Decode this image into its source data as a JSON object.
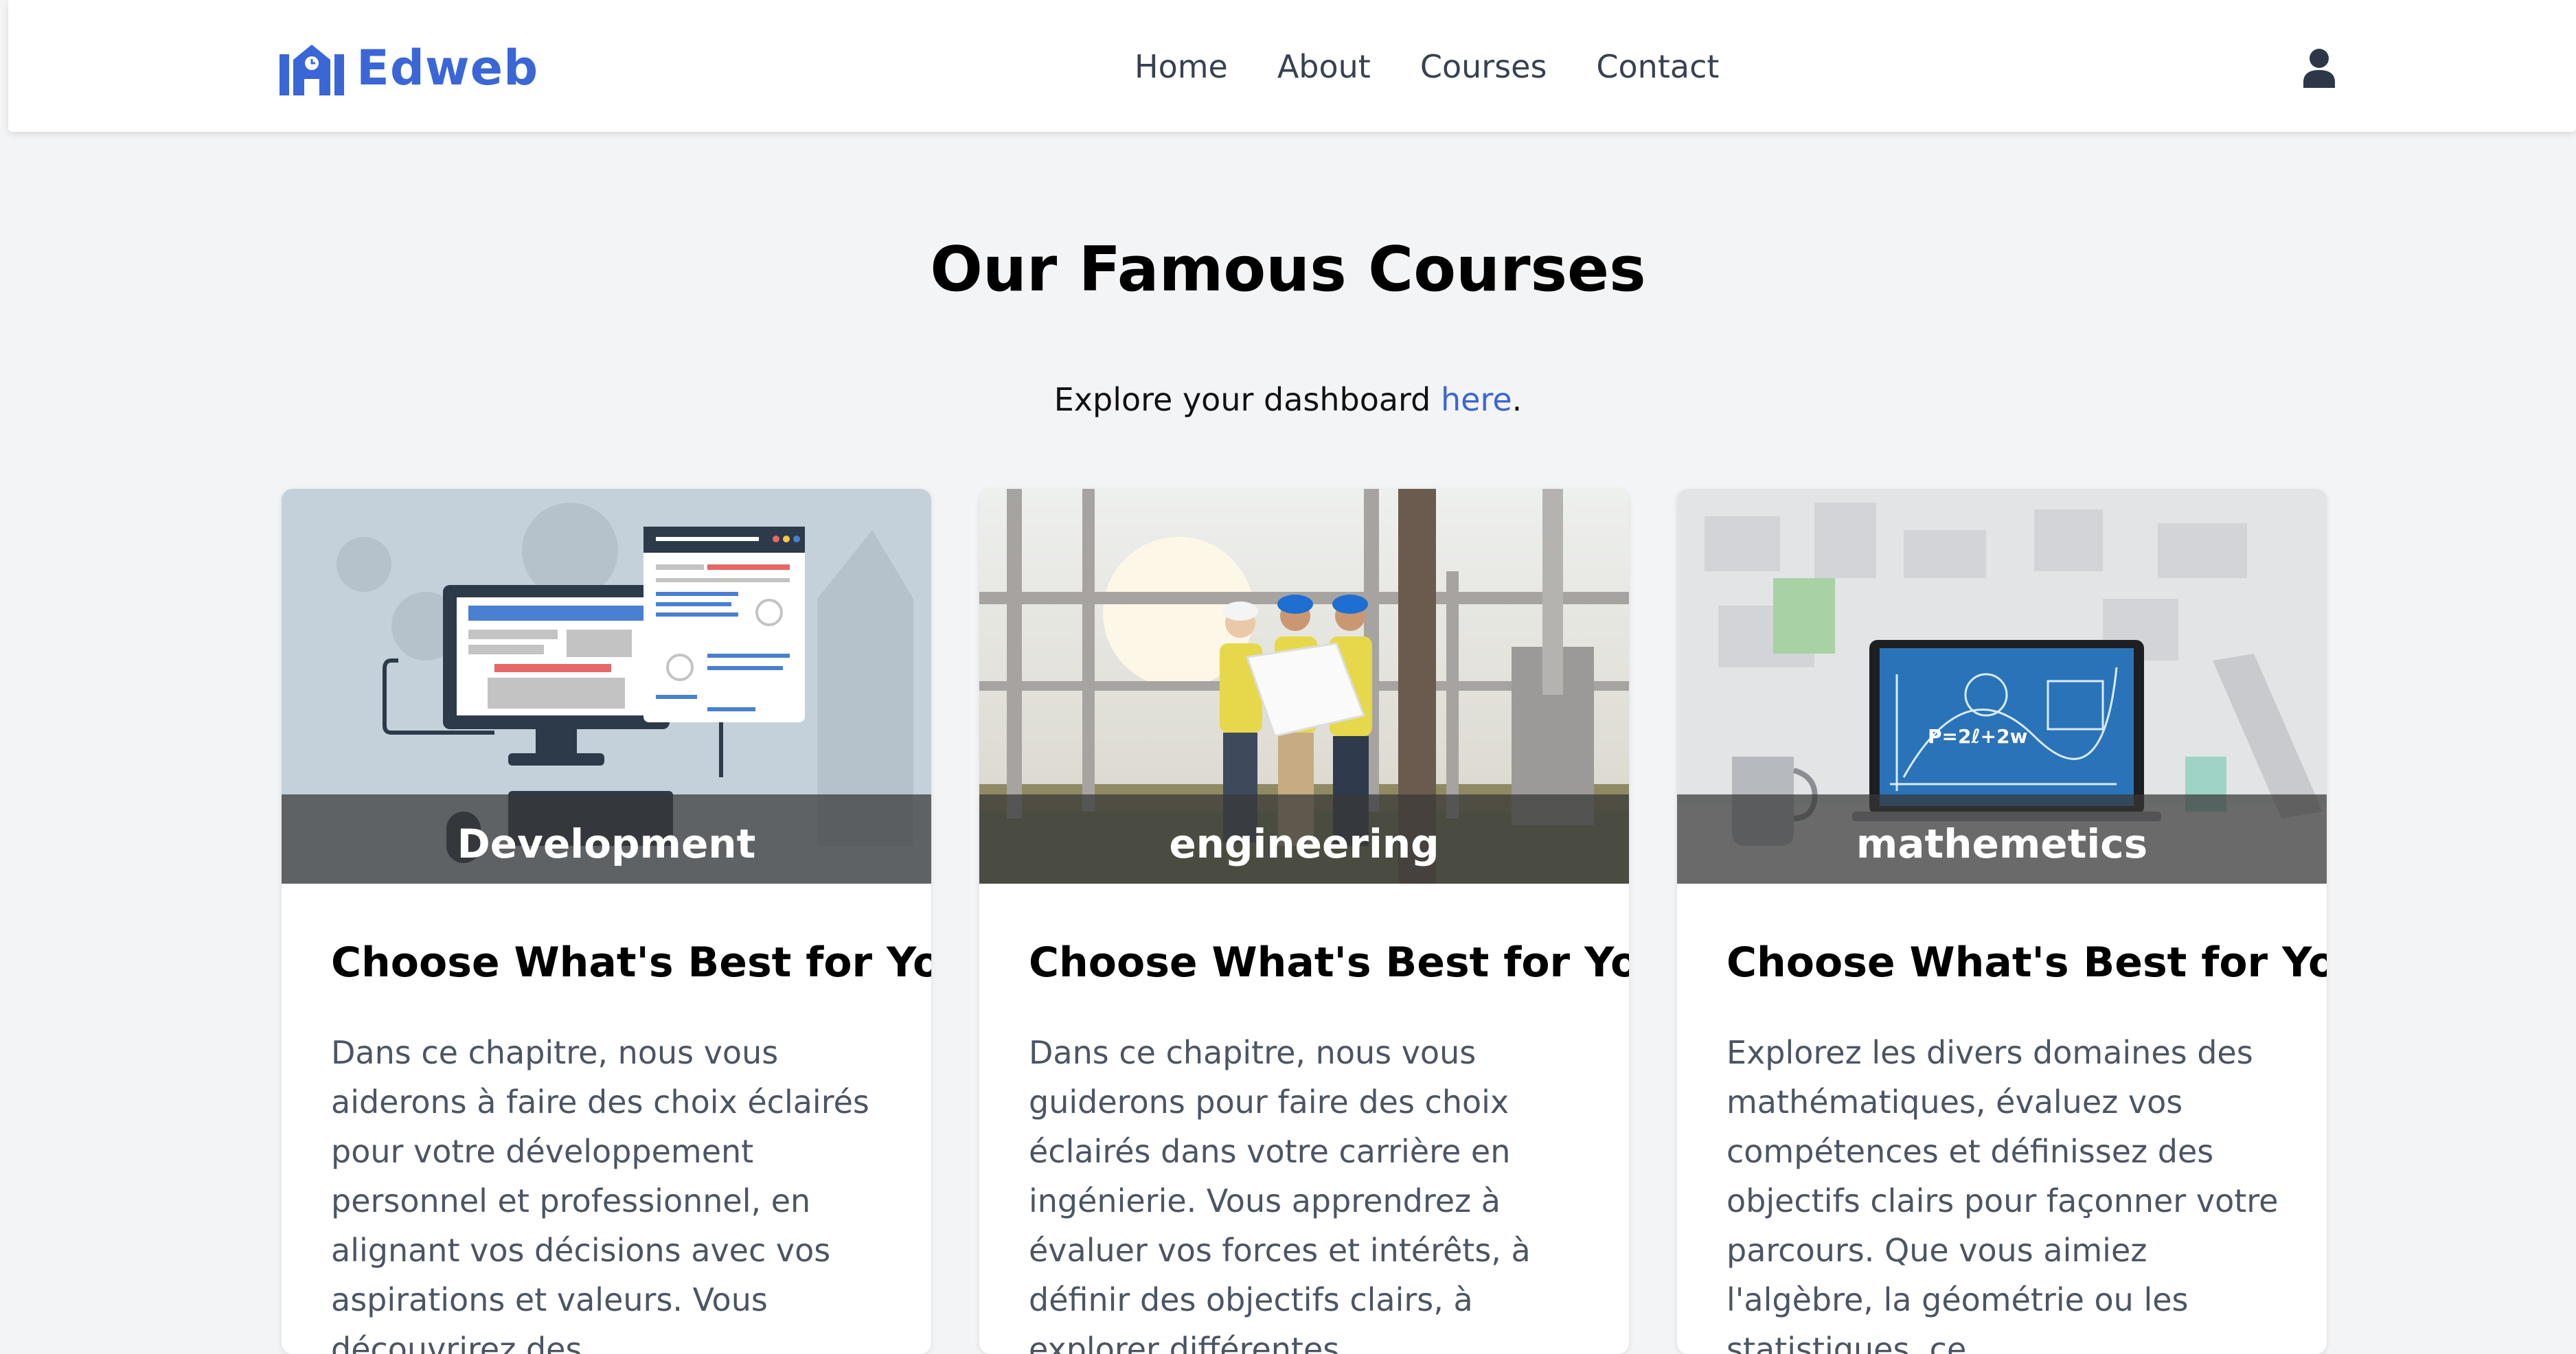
{
  "brand": {
    "name": "Edweb"
  },
  "nav": {
    "items": [
      "Home",
      "About",
      "Courses",
      "Contact"
    ]
  },
  "main": {
    "heading": "Our Famous Courses",
    "explore_text": "Explore your dashboard ",
    "explore_link": "here",
    "explore_end": "."
  },
  "cards": [
    {
      "category": "Development",
      "title": "Choose What's Best for You!",
      "text": "Dans ce chapitre, nous vous aiderons à faire des choix éclairés pour votre développement personnel et professionnel, en alignant vos décisions avec vos aspirations et valeurs. Vous découvrirez des"
    },
    {
      "category": "engineering",
      "title": "Choose What's Best for You!",
      "text": "Dans ce chapitre, nous vous guiderons pour faire des choix éclairés dans votre carrière en ingénierie. Vous apprendrez à évaluer vos forces et intérêts, à définir des objectifs clairs, à explorer différentes"
    },
    {
      "category": "mathemetics",
      "title": "Choose What's Best for You!",
      "text": "Explorez les divers domaines des mathématiques, évaluez vos compétences et définissez des objectifs clairs pour façonner votre parcours. Que vous aimiez l'algèbre, la géométrie ou les statistiques, ce"
    }
  ],
  "colors": {
    "accent": "#3b66d6",
    "nav_text": "#374151",
    "body_text": "#4b5563",
    "page_bg": "#f3f4f6"
  },
  "icons": {
    "logo": "school-icon",
    "user": "user-icon"
  }
}
